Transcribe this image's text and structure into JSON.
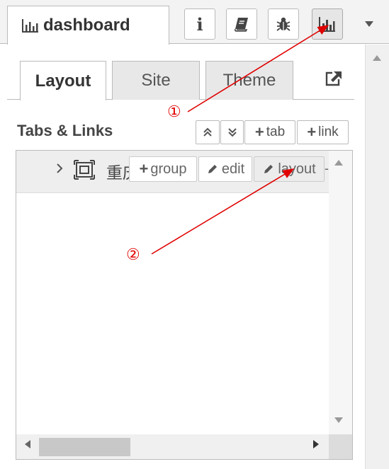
{
  "header": {
    "sidebar_tab_label": "dashboard",
    "icons": [
      "bar-chart-icon",
      "info-icon",
      "book-icon",
      "bug-icon",
      "dashboard-chart-icon",
      "caret-down-icon"
    ],
    "info_glyph": "i"
  },
  "inner_tabs": {
    "items": [
      {
        "label": "Layout",
        "active": true
      },
      {
        "label": "Site",
        "active": false
      },
      {
        "label": "Theme",
        "active": false
      }
    ]
  },
  "section": {
    "title": "Tabs & Links",
    "buttons": {
      "expand_all": "⌃⌃",
      "collapse_all": "⌄⌄",
      "add_tab": "tab",
      "add_link": "link"
    }
  },
  "tree": {
    "rows": [
      {
        "label": "重庆",
        "buttons": {
          "group": "group",
          "edit": "edit",
          "layout": "layout"
        }
      }
    ]
  },
  "annotations": {
    "marker_1": "①",
    "marker_2": "②",
    "color": "#e00000"
  }
}
